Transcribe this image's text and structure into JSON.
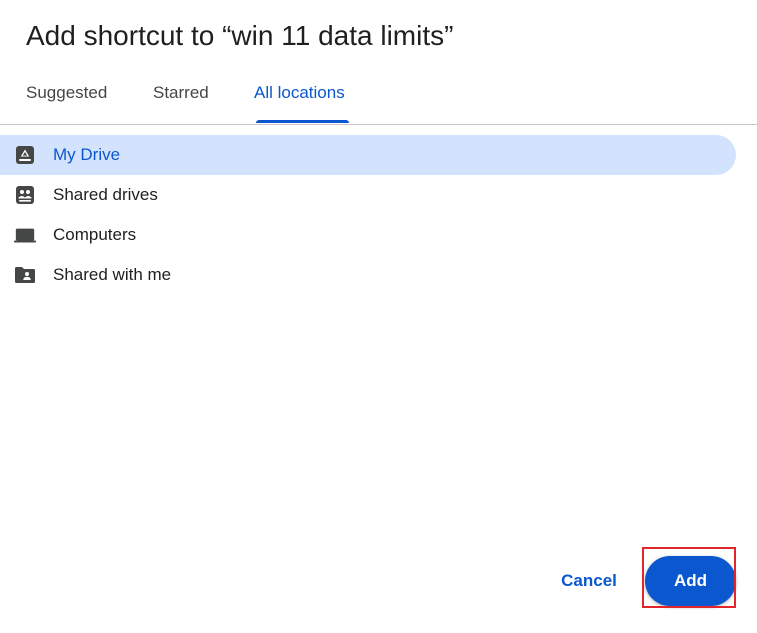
{
  "dialog": {
    "title": "Add shortcut to “win 11 data limits”"
  },
  "tabs": [
    {
      "label": "Suggested",
      "active": false
    },
    {
      "label": "Starred",
      "active": false
    },
    {
      "label": "All locations",
      "active": true
    }
  ],
  "locations": [
    {
      "label": "My Drive",
      "icon": "my-drive-icon",
      "selected": true
    },
    {
      "label": "Shared drives",
      "icon": "shared-drives-icon",
      "selected": false
    },
    {
      "label": "Computers",
      "icon": "computer-icon",
      "selected": false
    },
    {
      "label": "Shared with me",
      "icon": "shared-folder-icon",
      "selected": false
    }
  ],
  "actions": {
    "cancel_label": "Cancel",
    "add_label": "Add"
  },
  "colors": {
    "accent": "#0b57d0",
    "selected_bg": "#d3e3fd",
    "highlight_border": "#e0262a"
  }
}
